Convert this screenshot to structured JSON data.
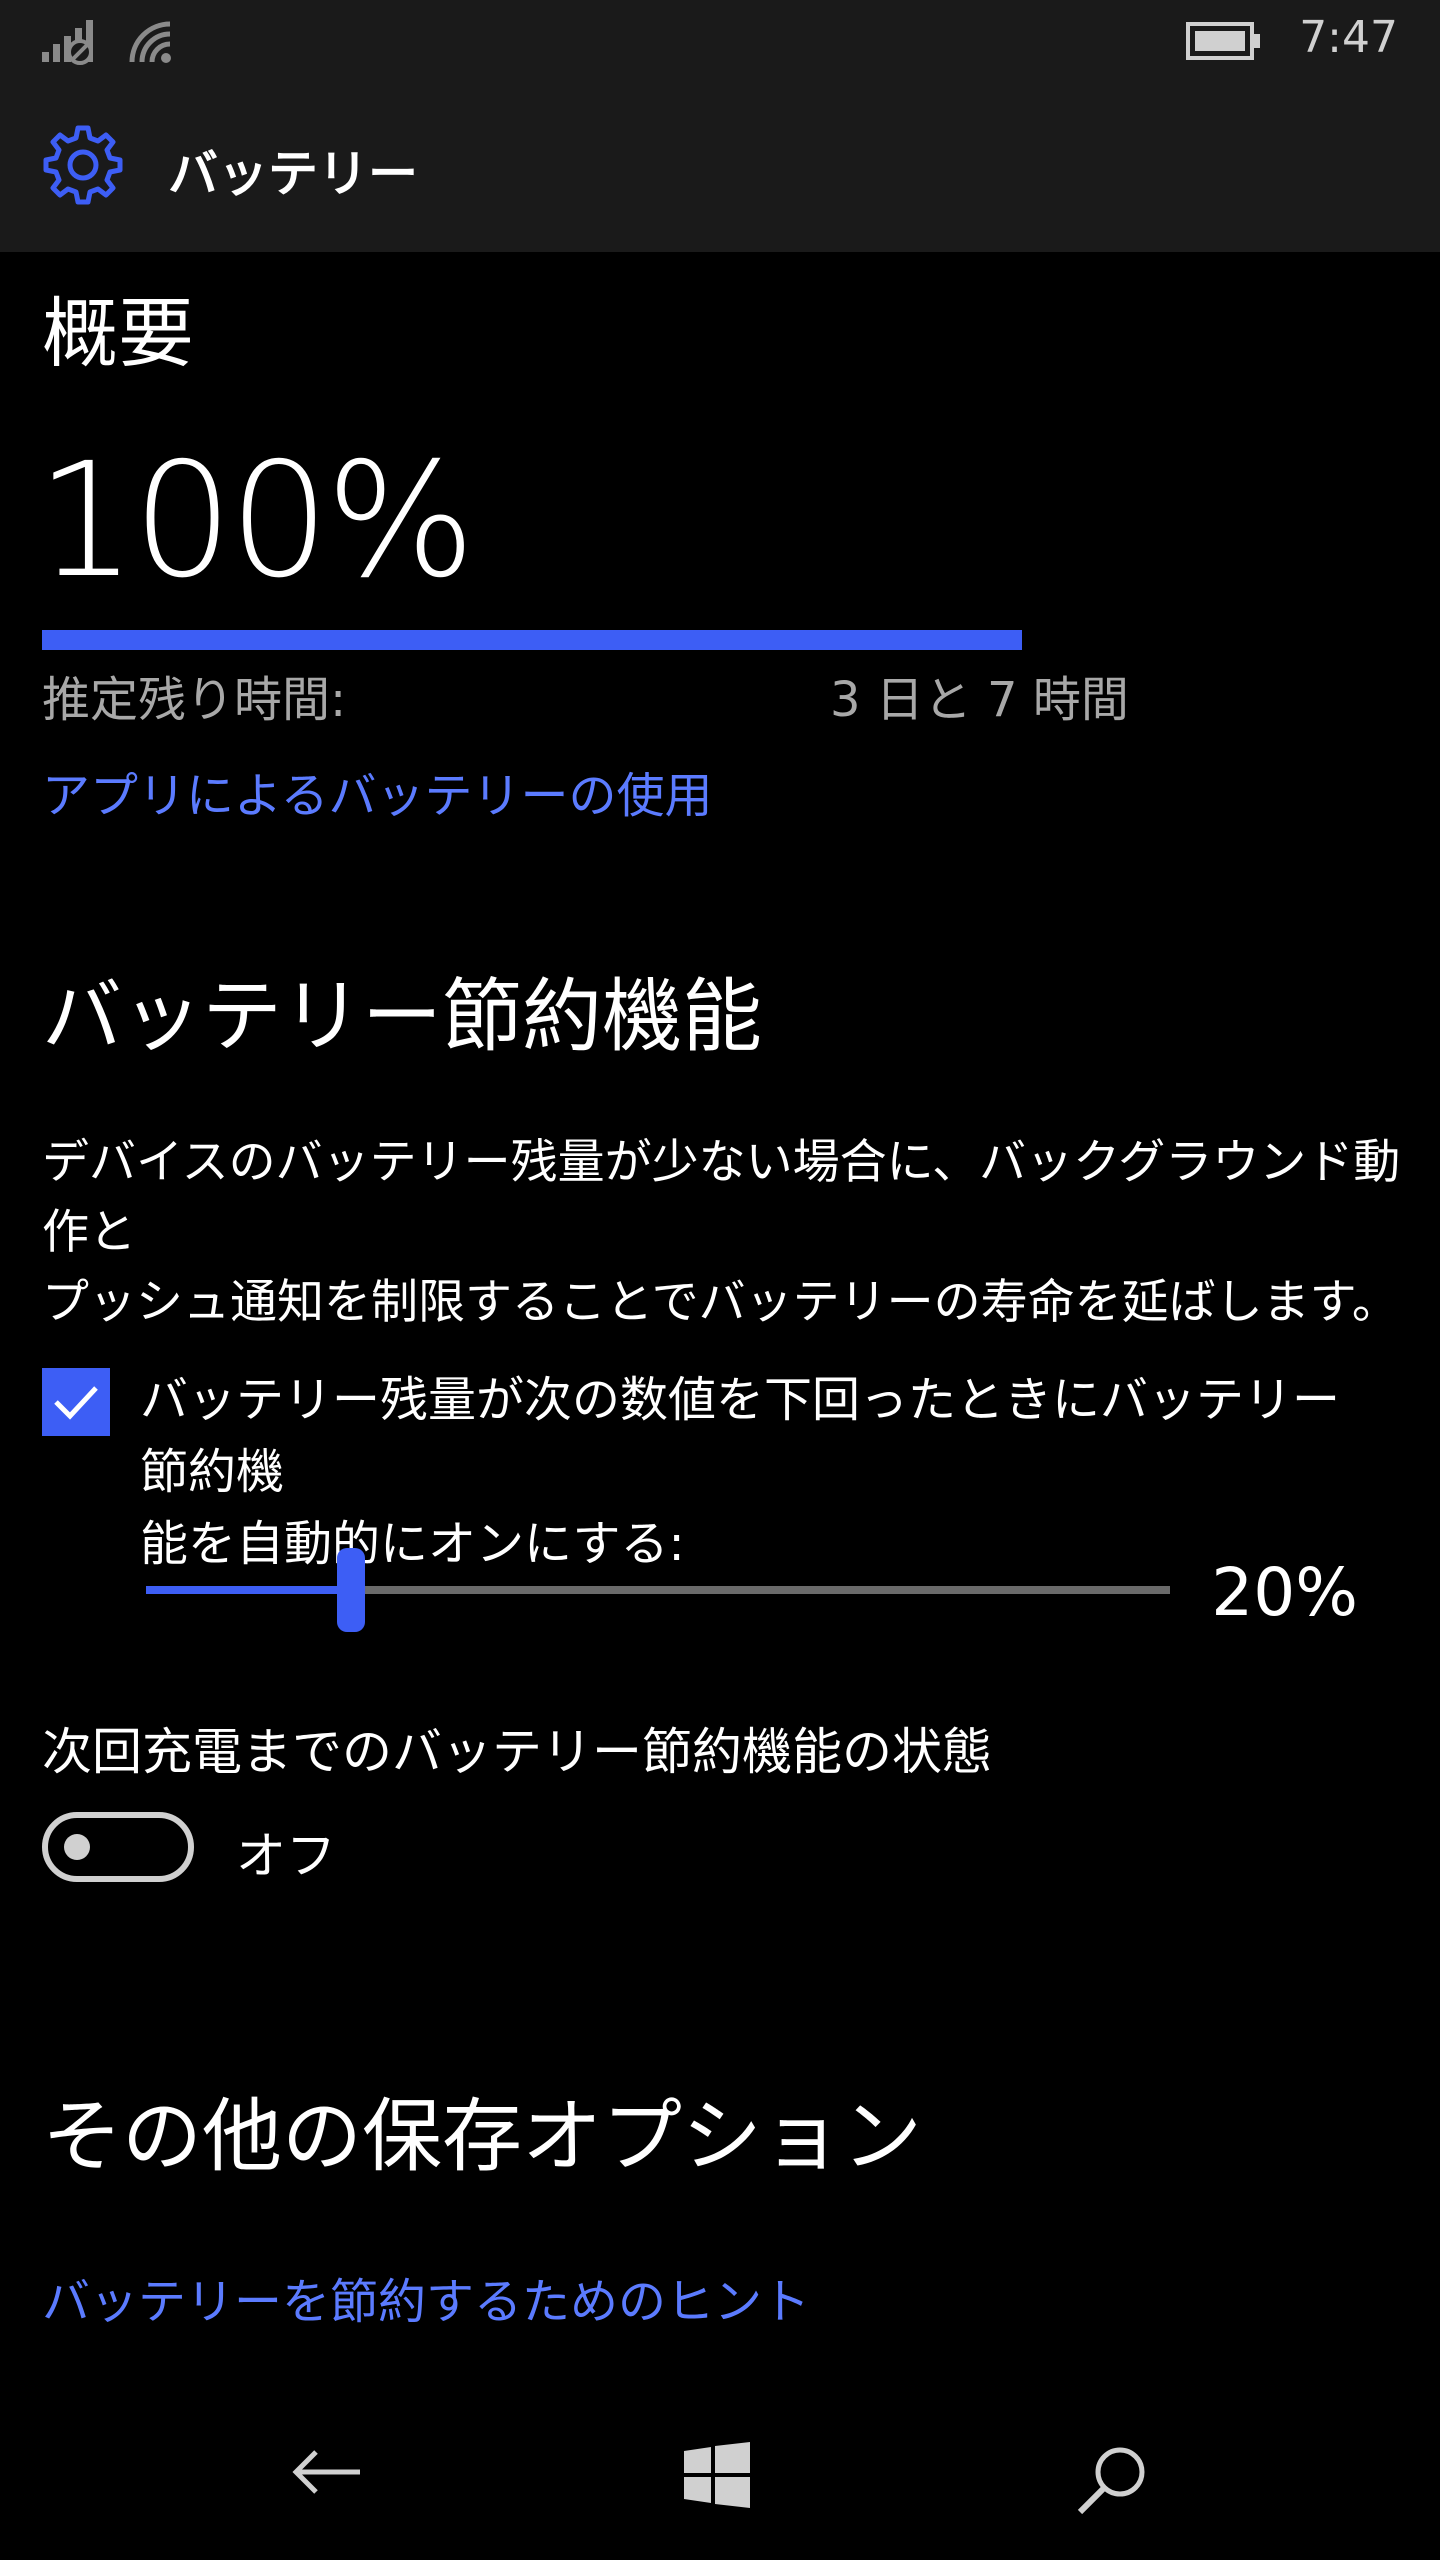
{
  "status_bar": {
    "time": "7:47",
    "icons": [
      "signal-icon",
      "wifi-icon",
      "battery-icon"
    ]
  },
  "header": {
    "icon": "gear-icon",
    "title": "バッテリー"
  },
  "overview": {
    "heading": "概要",
    "percent_text": "100%",
    "level": 1.0,
    "remaining_label": "推定残り時間:",
    "remaining_value": "3 日と 7 時間",
    "apps_link": "アプリによるバッテリーの使用"
  },
  "saver": {
    "heading": "バッテリー節約機能",
    "description_line1": "デバイスのバッテリー残量が少ない場合に、バックグラウンド動作と",
    "description_line2": "プッシュ通知を制限することでバッテリーの寿命を延ばします。",
    "auto_checkbox_checked": true,
    "auto_label_line1": "バッテリー残量が次の数値を下回ったときにバッテリー節約機",
    "auto_label_line2": "能を自動的にオンにする:",
    "threshold": 0.2,
    "threshold_text": "20%",
    "state_label": "次回充電までのバッテリー節約機能の状態",
    "toggle_on": false,
    "toggle_text": "オフ"
  },
  "other": {
    "heading": "その他の保存オプション",
    "tips_link": "バッテリーを節約するためのヒント"
  },
  "nav": {
    "icons": [
      "back-arrow-icon",
      "windows-icon",
      "search-icon"
    ]
  },
  "colors": {
    "accent": "#3d5ef5",
    "link": "#5b7bff",
    "bar_bg": "#1a1a1a",
    "background": "#000000",
    "secondary_text": "#a8a8a8"
  }
}
